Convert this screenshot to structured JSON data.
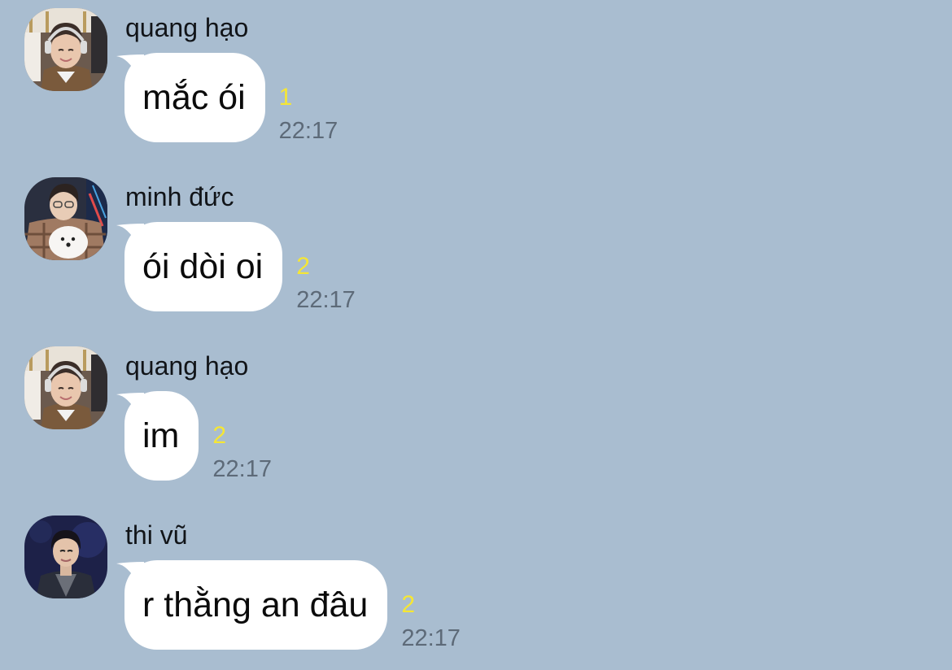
{
  "messages": [
    {
      "sender": "quang hạo",
      "text": "mắc ói",
      "unread": "1",
      "time": "22:17",
      "avatar": "quang-hao-avatar"
    },
    {
      "sender": "minh đức",
      "text": "ói dòi oi",
      "unread": "2",
      "time": "22:17",
      "avatar": "minh-duc-avatar"
    },
    {
      "sender": "quang hạo",
      "text": "im",
      "unread": "2",
      "time": "22:17",
      "avatar": "quang-hao-avatar"
    },
    {
      "sender": "thi vũ",
      "text": "r thằng an đâu",
      "unread": "2",
      "time": "22:17",
      "avatar": "thi-vu-avatar"
    }
  ],
  "colors": {
    "background": "#a9bdd0",
    "bubble": "#ffffff",
    "unread": "#f5e635",
    "time": "#5d6a78"
  }
}
